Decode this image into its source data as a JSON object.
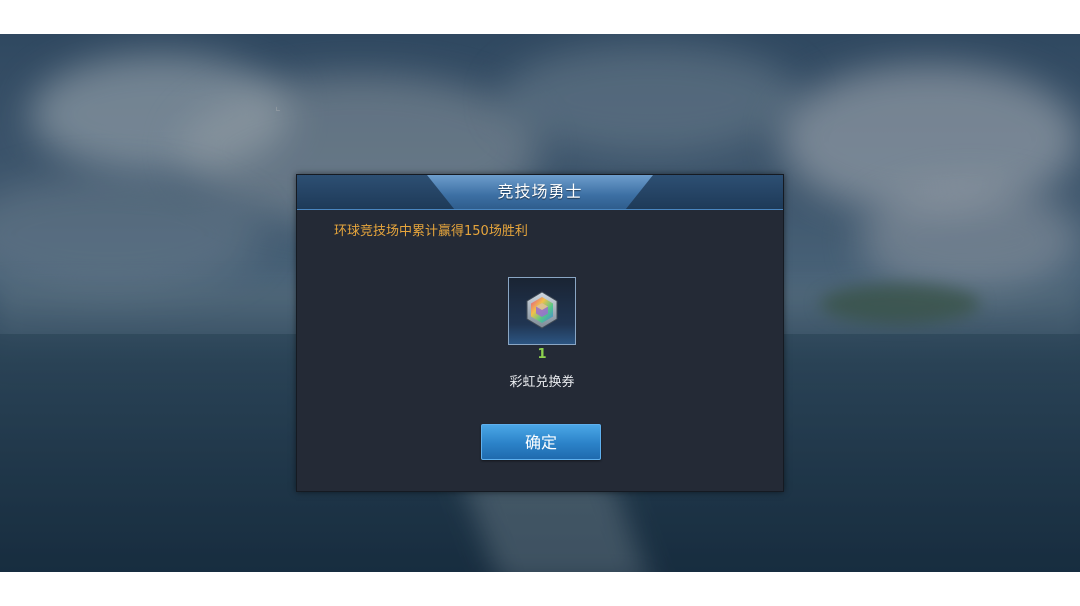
{
  "dialog": {
    "title": "竞技场勇士",
    "description": "环球竞技场中累计赢得150场胜利",
    "reward": {
      "icon": "rainbow-gem-icon",
      "count": "1",
      "name": "彩虹兑换券"
    },
    "confirm_label": "确定"
  },
  "colors": {
    "description": "#e6a53c",
    "count": "#8dd24f",
    "button": "#2b82c8"
  }
}
